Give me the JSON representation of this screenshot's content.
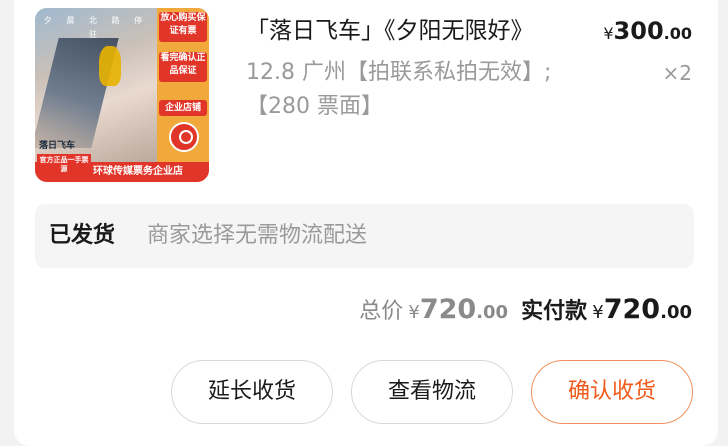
{
  "product": {
    "image": {
      "banner_top": "夕 晨 北 路 停 驻",
      "logo_text": "落日飞车",
      "tag_1": "放心购买保证有票",
      "tag_2": "看完确认正品保证",
      "tag_3": "企业店铺",
      "bottom_left": "官方正品一手票源",
      "bottom_right": "环球传媒票务企业店"
    },
    "title": "「落日飞车」《夕阳无限好》",
    "price": {
      "currency": "¥",
      "integer": "300",
      "decimal": ".00"
    },
    "spec": "12.8 广州【拍联系私拍无效】;【280 票面】",
    "quantity": "×2"
  },
  "shipping": {
    "status_label": "已发货",
    "status_text": "商家选择无需物流配送"
  },
  "totals": {
    "total_label": "总价",
    "total_currency": "¥",
    "total_integer": "720",
    "total_decimal": ".00",
    "paid_label": "实付款",
    "paid_currency": "¥",
    "paid_integer": "720",
    "paid_decimal": ".00"
  },
  "actions": {
    "extend_label": "延长收货",
    "logistics_label": "查看物流",
    "confirm_label": "确认收货"
  },
  "colors": {
    "accent": "#f05a1a",
    "accent_border": "#f09060",
    "muted": "#9a9a9a"
  }
}
